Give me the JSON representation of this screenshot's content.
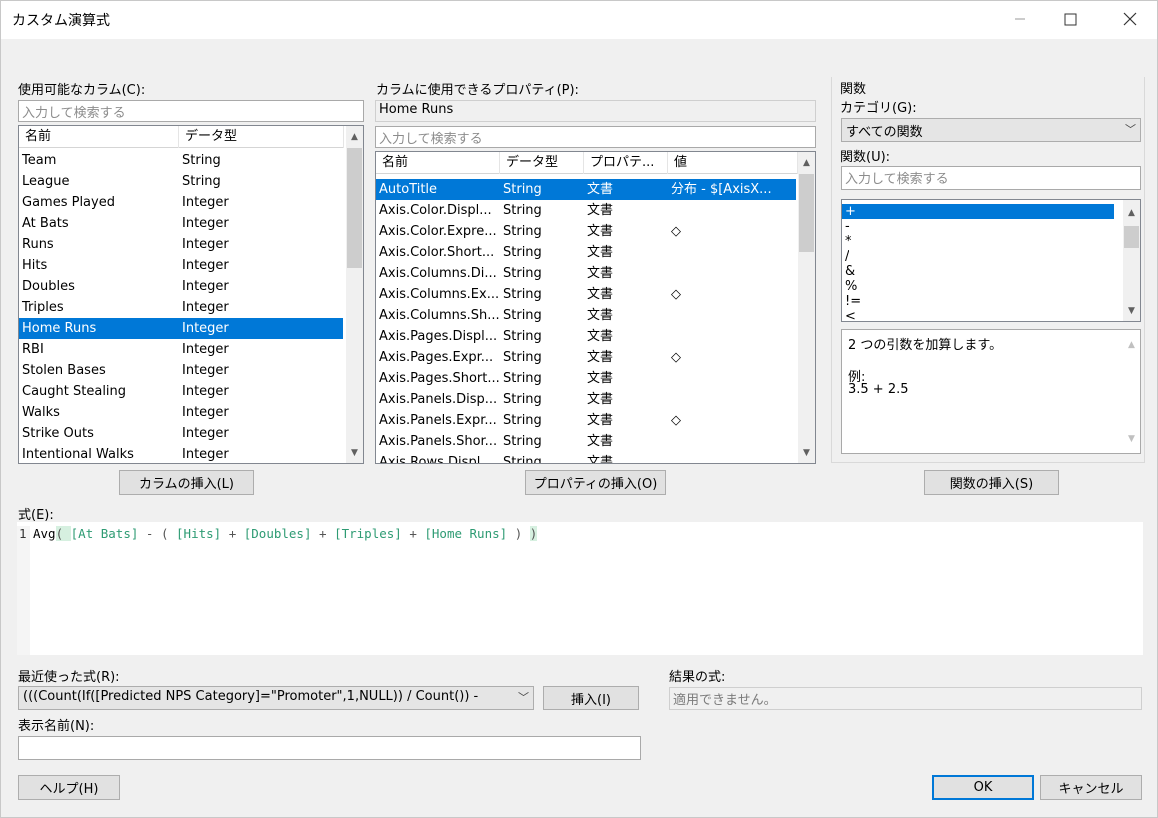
{
  "window": {
    "title": "カスタム演算式"
  },
  "columns": {
    "label": "使用可能なカラム(C):",
    "search_placeholder": "入力して検索する",
    "headers": [
      "名前",
      "データ型"
    ],
    "rows": [
      {
        "name": "Team",
        "type": "String"
      },
      {
        "name": "League",
        "type": "String"
      },
      {
        "name": "Games Played",
        "type": "Integer"
      },
      {
        "name": "At Bats",
        "type": "Integer"
      },
      {
        "name": "Runs",
        "type": "Integer"
      },
      {
        "name": "Hits",
        "type": "Integer"
      },
      {
        "name": "Doubles",
        "type": "Integer"
      },
      {
        "name": "Triples",
        "type": "Integer"
      },
      {
        "name": "Home Runs",
        "type": "Integer"
      },
      {
        "name": "RBI",
        "type": "Integer"
      },
      {
        "name": "Stolen Bases",
        "type": "Integer"
      },
      {
        "name": "Caught Stealing",
        "type": "Integer"
      },
      {
        "name": "Walks",
        "type": "Integer"
      },
      {
        "name": "Strike Outs",
        "type": "Integer"
      },
      {
        "name": "Intentional Walks",
        "type": "Integer"
      }
    ],
    "selected_index": 8,
    "insert_button": "カラムの挿入(L)"
  },
  "properties": {
    "label": "カラムに使用できるプロパティ(P):",
    "current_column": "Home Runs",
    "search_placeholder": "入力して検索する",
    "headers": [
      "名前",
      "データ型",
      "プロパテ...",
      "値"
    ],
    "rows": [
      {
        "name": "AutoTitle",
        "type": "String",
        "prop": "文書",
        "value": "分布 - $[AxisX..."
      },
      {
        "name": "Axis.Color.Displ...",
        "type": "String",
        "prop": "文書",
        "value": ""
      },
      {
        "name": "Axis.Color.Expre...",
        "type": "String",
        "prop": "文書",
        "value": "◇"
      },
      {
        "name": "Axis.Color.Short...",
        "type": "String",
        "prop": "文書",
        "value": ""
      },
      {
        "name": "Axis.Columns.Di...",
        "type": "String",
        "prop": "文書",
        "value": ""
      },
      {
        "name": "Axis.Columns.Ex...",
        "type": "String",
        "prop": "文書",
        "value": "◇"
      },
      {
        "name": "Axis.Columns.Sh...",
        "type": "String",
        "prop": "文書",
        "value": ""
      },
      {
        "name": "Axis.Pages.Displ...",
        "type": "String",
        "prop": "文書",
        "value": ""
      },
      {
        "name": "Axis.Pages.Expr...",
        "type": "String",
        "prop": "文書",
        "value": "◇"
      },
      {
        "name": "Axis.Pages.Short...",
        "type": "String",
        "prop": "文書",
        "value": ""
      },
      {
        "name": "Axis.Panels.Disp...",
        "type": "String",
        "prop": "文書",
        "value": ""
      },
      {
        "name": "Axis.Panels.Expr...",
        "type": "String",
        "prop": "文書",
        "value": "◇"
      },
      {
        "name": "Axis.Panels.Shor...",
        "type": "String",
        "prop": "文書",
        "value": ""
      },
      {
        "name": "Axis.Rows.Displ...",
        "type": "String",
        "prop": "文書",
        "value": ""
      }
    ],
    "selected_index": 0,
    "insert_button": "プロパティの挿入(O)"
  },
  "functions": {
    "group_label": "関数",
    "category_label": "カテゴリ(G):",
    "category_value": "すべての関数",
    "function_label": "関数(U):",
    "search_placeholder": "入力して検索する",
    "items": [
      "+",
      "-",
      "*",
      "/",
      "&",
      "%",
      "!=",
      "<"
    ],
    "selected_index": 0,
    "description": "2 つの引数を加算します。",
    "example_label": "例:",
    "example_code": "3.5 + 2.5",
    "insert_button": "関数の挿入(S)"
  },
  "expression": {
    "label": "式(E):",
    "line_number": "1",
    "tokens": [
      {
        "t": "Avg",
        "c": "kw"
      },
      {
        "t": "( ",
        "c": "op"
      },
      {
        "t": "[At Bats]",
        "c": "col"
      },
      {
        "t": " - ( ",
        "c": "op"
      },
      {
        "t": "[Hits]",
        "c": "col"
      },
      {
        "t": " + ",
        "c": "op"
      },
      {
        "t": "[Doubles]",
        "c": "col"
      },
      {
        "t": " + ",
        "c": "op"
      },
      {
        "t": "[Triples]",
        "c": "col"
      },
      {
        "t": " + ",
        "c": "op"
      },
      {
        "t": "[Home Runs]",
        "c": "col"
      },
      {
        "t": " ) ",
        "c": "op"
      },
      {
        "t": ")",
        "c": "op"
      }
    ]
  },
  "recent": {
    "label": "最近使った式(R):",
    "value": "(((Count(If([Predicted NPS Category]=\"Promoter\",1,NULL)) / Count()) -",
    "insert_button": "挿入(I)"
  },
  "result": {
    "label": "結果の式:",
    "value": "適用できません。"
  },
  "display_name": {
    "label": "表示名前(N):",
    "value": ""
  },
  "footer": {
    "help": "ヘルプ(H)",
    "ok": "OK",
    "cancel": "キャンセル"
  },
  "colors": {
    "selection": "#0078d7",
    "column_token": "#2e9b73",
    "default_button_border": "#0078d7"
  }
}
